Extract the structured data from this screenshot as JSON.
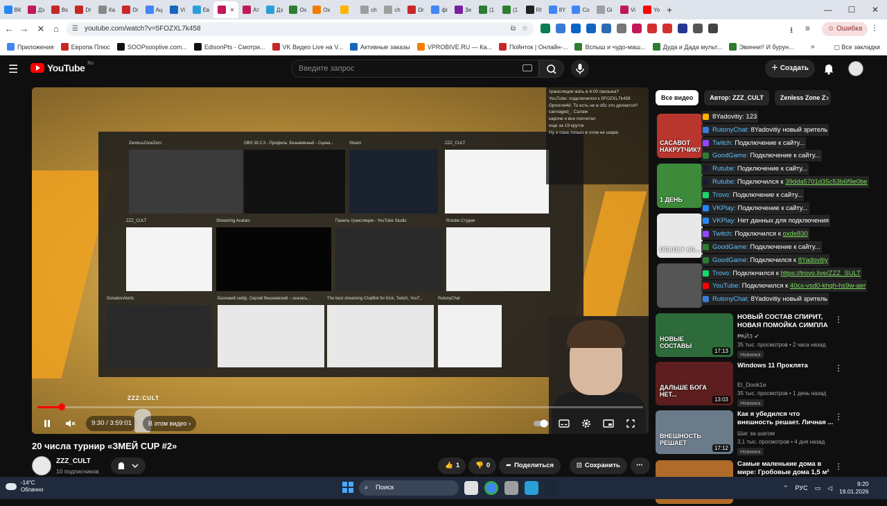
{
  "browser": {
    "tabs": [
      {
        "label": "ВК",
        "color": "#2787f5"
      },
      {
        "label": "Дз",
        "color": "#c2185b"
      },
      {
        "label": "Вх",
        "color": "#c62828"
      },
      {
        "label": "Dr",
        "color": "#c62828"
      },
      {
        "label": "Ка",
        "color": "#888888"
      },
      {
        "label": "Dr",
        "color": "#c62828"
      },
      {
        "label": "Ац",
        "color": "#4285f4"
      },
      {
        "label": "Vi",
        "color": "#1565c0"
      },
      {
        "label": "Ев",
        "color": "#2aa0d8"
      },
      {
        "label": "",
        "color": "#c2185b",
        "active": true
      },
      {
        "label": "Ат",
        "color": "#c2185b"
      },
      {
        "label": "Дз",
        "color": "#2aa0d8"
      },
      {
        "label": "Ох",
        "color": "#2e7d32"
      },
      {
        "label": "Ох",
        "color": "#f57c00"
      },
      {
        "label": "",
        "color": "#ffb300"
      },
      {
        "label": "ch",
        "color": "#9e9e9e"
      },
      {
        "label": "ch",
        "color": "#9e9e9e"
      },
      {
        "label": "Dr",
        "color": "#c62828"
      },
      {
        "label": "фі",
        "color": "#4285f4"
      },
      {
        "label": "Зе",
        "color": "#7b1fa2"
      },
      {
        "label": "(1",
        "color": "#2e7d32"
      },
      {
        "label": "(1",
        "color": "#2e7d32"
      },
      {
        "label": "Rt",
        "color": "#212121"
      },
      {
        "label": "8Y",
        "color": "#4285f4"
      },
      {
        "label": "Co",
        "color": "#4285f4"
      },
      {
        "label": "Gi",
        "color": "#9e9e9e"
      },
      {
        "label": "Vi",
        "color": "#c2185b"
      },
      {
        "label": "Yo",
        "color": "#ff0000"
      }
    ],
    "new_tab": "+",
    "window_controls": [
      "—",
      "☐",
      "✕"
    ],
    "url": "youtube.com/watch?v=5FOZXL7k458",
    "error_button": "Ошибка",
    "extension_colors": [
      "#0a7d52",
      "#3a7bd5",
      "#0a63c9",
      "#1565c0",
      "#2b6cb0",
      "#777777",
      "#c2185b",
      "#d32f2f",
      "#d32f2f",
      "#283593",
      "#555555",
      "#444444"
    ],
    "bookmarks": [
      {
        "label": "Приложения",
        "color": "#4285f4"
      },
      {
        "label": "Европа Плюс",
        "color": "#c62828"
      },
      {
        "label": "SOOPsooplive.com...",
        "color": "#111111"
      },
      {
        "label": "EdisonPts - Смотри...",
        "color": "#111111"
      },
      {
        "label": "VK Видео Live на V...",
        "color": "#c62828"
      },
      {
        "label": "Активные заказы",
        "color": "#1565c0"
      },
      {
        "label": "VPROBIVE.RU — Ка...",
        "color": "#f57c00"
      },
      {
        "label": "Пойнток | Онлайн-...",
        "color": "#c62828"
      },
      {
        "label": "Вспыш и чудо-маш...",
        "color": "#2e7d32"
      },
      {
        "label": "Дуда и Дада мульт...",
        "color": "#2e7d32"
      },
      {
        "label": "Эвинни!! И бурун...",
        "color": "#2e7d32"
      }
    ],
    "all_bookmarks": "Все закладки"
  },
  "header": {
    "logo": "YouTube",
    "logo_region": "RU",
    "search_placeholder": "Введите запрос",
    "create_label": "Создать"
  },
  "player": {
    "current_time": "9:30",
    "duration": "3:59:01",
    "time_text": "9:30 / 3:59:01",
    "progress_fraction": 0.04,
    "chapter_label": "В этом видео",
    "overlay_handle": "ZZZ:CULT",
    "windows": [
      {
        "caption": "ZenlessZoneZero"
      },
      {
        "caption": "OBS 30.2.3 - Профиль: Безымянный - Сцена..."
      },
      {
        "caption": "Steam"
      },
      {
        "caption": "ZZZ_CULT"
      },
      {
        "caption": "ZZZ_CULT"
      },
      {
        "caption": "Streaming Avatars"
      },
      {
        "caption": "Панель трансляции - YouTube Studio"
      },
      {
        "caption": "Rutube Студия"
      },
      {
        "caption": "DonationAlerts"
      },
      {
        "caption": "Безликий сейф, Сергей Вишневский – скачать..."
      },
      {
        "caption": "The best streaming ChatBot for Kick, Twitch, YouT..."
      },
      {
        "caption": "RutonyChat"
      }
    ],
    "stream_chat": [
      "трансляции жать в 4:00 свизыка?",
      "YouTube: подключился к 5FOZXL7k458",
      "Оргигли4ё: То есть не в обс это делается?",
      "cannaged_: Салам",
      "кароче я все посчитал",
      "еще за 19 круток",
      "Ну я пока только в этом не шарю"
    ]
  },
  "video": {
    "title": "20 числа турнир «ЗМЕЙ CUP #2»",
    "channel": "ZZZ_CULT",
    "subscribers": "10 подписчиков",
    "likes": "1",
    "dislikes": "0",
    "share_label": "Поделиться",
    "save_label": "Сохранить"
  },
  "sidebar": {
    "chips": [
      "Все видео",
      "Автор: ZZZ_CULT",
      "Zenless Zone Z"
    ],
    "overlay_chat": [
      {
        "src": "",
        "msg": "8Yadovitiy: 123",
        "color": "#ffb300",
        "link": ""
      },
      {
        "src": "RutonyChat:",
        "msg": " 8Yadovitiy новый зритель",
        "color": "#3a7bd5",
        "link": ""
      },
      {
        "src": "Twitch:",
        "msg": " Подключение к сайту...",
        "color": "#9146ff",
        "link": ""
      },
      {
        "src": "GoodGame:",
        "msg": " Подключение к сайту...",
        "color": "#2e7d32",
        "link": ""
      },
      {
        "src": "Rutube:",
        "msg": " Подключение к сайту...",
        "color": "#1a1a2e",
        "link": ""
      },
      {
        "src": "Rutube:",
        "msg": " Подключился к ",
        "color": "#1a1a2e",
        "link": "39dda5701d35c53b6f9e0be"
      },
      {
        "src": "Trovo:",
        "msg": " Подключение к сайту...",
        "color": "#19d66b",
        "link": ""
      },
      {
        "src": "VKPlay:",
        "msg": " Подключение к сайту...",
        "color": "#2787f5",
        "link": ""
      },
      {
        "src": "VKPlay:",
        "msg": " Нет данных для подключения",
        "color": "#2787f5",
        "link": ""
      },
      {
        "src": "Twitch:",
        "msg": " Подключился к ",
        "color": "#9146ff",
        "link": "oxde830"
      },
      {
        "src": "GoodGame:",
        "msg": " Подключение к сайту...",
        "color": "#2e7d32",
        "link": ""
      },
      {
        "src": "GoodGame:",
        "msg": " Подключился к ",
        "color": "#2e7d32",
        "link": "8Yadovitiy"
      },
      {
        "src": "Trovo:",
        "msg": " Подключился к ",
        "color": "#19d66b",
        "link": "https://trovo.live/ZZZ_SULT"
      },
      {
        "src": "YouTube:",
        "msg": " Подключился к ",
        "color": "#ff0000",
        "link": "40cx-vsd0-khqh-hs9w-aer"
      },
      {
        "src": "RutonyChat:",
        "msg": " 8Yadovitiy новый зритель",
        "color": "#3a7bd5",
        "link": ""
      }
    ],
    "videos": [
      {
        "title": "НОВЫЙ СОСТАВ СПИРИТ, НОВАЯ ПОМОЙКА СИМПЛА ...",
        "channel": "РАЙЗ ✔",
        "meta": "35 тыс. просмотров • 2 часа назад",
        "badge": "Новинка",
        "duration": "17:13",
        "color": "#2d6b3a",
        "overlay": "НОВЫЕ СОСТАВЫ"
      },
      {
        "title": "Windows 11 Проклята",
        "channel": "El_Dook1e",
        "meta": "35 тыс. просмотров • 1 день назад",
        "badge": "Новинка",
        "duration": "13:03",
        "color": "#5c1e1e",
        "overlay": "ДАЛЬШЕ БОГА НЕТ..."
      },
      {
        "title": "Как я убедился что внешность решает. Личная ...",
        "channel": "Шаг за шагом",
        "meta": "3,1 тыс. просмотров • 4 дня назад",
        "badge": "Новинка",
        "duration": "17:12",
        "color": "#6b7b8a",
        "overlay": "ВНЕШНОСТЬ РЕШАЕТ"
      },
      {
        "title": "Самые маленькие дома в мире: Гробовые дома 1,5 м² ...",
        "channel": "",
        "meta": "",
        "badge": "",
        "duration": "",
        "color": "#b06a2a",
        "overlay": ""
      }
    ],
    "hidden_thumbs": [
      {
        "overlay": "САСАВОТ НАКРУТЧИК?",
        "color": "#b9362f"
      },
      {
        "overlay": "1 ДЕНЬ",
        "color": "#3c8a3a"
      },
      {
        "overlay": "DEADLY AS...",
        "color": "#e8e8e8"
      },
      {
        "overlay": "",
        "color": "#555555"
      }
    ]
  },
  "taskbar": {
    "temperature": "-14°C",
    "weather": "Облачно",
    "search_label": "Поиск",
    "lang": "РУС",
    "time": "9:20",
    "date": "19.01.2026",
    "app_colors": [
      "#e0e0e0",
      "#4285f4",
      "#9e9e9e",
      "#2aa0d8",
      "#1b2838"
    ]
  }
}
